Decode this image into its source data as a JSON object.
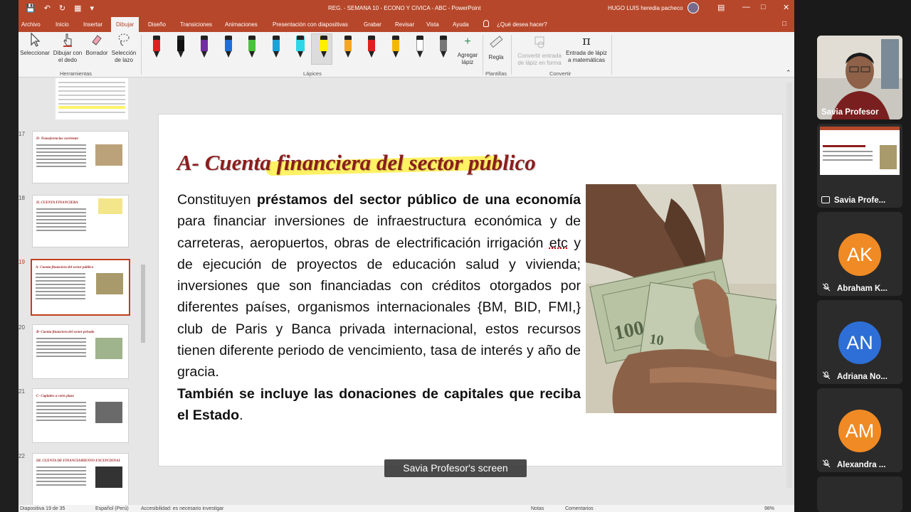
{
  "window": {
    "title": "REG. - SEMANA 10 - ECONO Y CIVICA - ABC  -  PowerPoint",
    "user": "HUGO LUIS heredia pacheco"
  },
  "tabs": [
    {
      "label": "Archivo"
    },
    {
      "label": "Inicio"
    },
    {
      "label": "Insertar"
    },
    {
      "label": "Dibujar"
    },
    {
      "label": "Diseño"
    },
    {
      "label": "Transiciones"
    },
    {
      "label": "Animaciones"
    },
    {
      "label": "Presentación con diapositivas"
    },
    {
      "label": "Grabar"
    },
    {
      "label": "Revisar"
    },
    {
      "label": "Vista"
    },
    {
      "label": "Ayuda"
    },
    {
      "label": "¿Qué desea hacer?"
    }
  ],
  "ribbon": {
    "select": "Seleccionar",
    "finger": "Dibujar con el dedo",
    "eraser": "Borrador",
    "lasso": "Selección de lazo",
    "group_tools": "Herramientas",
    "group_pens": "Lápices",
    "add_pen": "Agregar lápiz",
    "ruler": "Regla",
    "group_stencils": "Plantillas",
    "ink_to_shape": "Convertir entrada de lápiz en forma",
    "ink_to_math": "Entrada de lápiz a matemáticas",
    "group_convert": "Convertir",
    "pen_colors": [
      "#e02020",
      "#111111",
      "#7030a0",
      "#1f6fd6",
      "#49c23c",
      "#1aa3d9",
      "#2fd6e6",
      "#fff000",
      "#f5a623",
      "#e02020",
      "#f5b800",
      "#ffffff",
      "#777777"
    ]
  },
  "thumbnails": [
    {
      "number": "17",
      "title": "D- Transferencias corrientes"
    },
    {
      "number": "18",
      "title": "II. CUENTA FINANCIERA"
    },
    {
      "number": "19",
      "title": "A- Cuenta financiera del sector público"
    },
    {
      "number": "20",
      "title": "B- Cuenta financiera del sector privado"
    },
    {
      "number": "21",
      "title": "C- Capitales a corto plazo"
    },
    {
      "number": "22",
      "title": "III. CUENTA DE FINANCIAMIENTO EXCEPCIONAL"
    }
  ],
  "slide": {
    "title": "A- Cuenta financiera del sector público",
    "p1_a": "Constituyen ",
    "p1_b": "préstamos del sector público de una economía",
    "p1_c": " para financiar inversiones de infraestructura económica y de carreteras, aeropuertos, obras de electrificación irrigación ",
    "p1_d": "etc",
    "p1_e": " y de ejecución de proyectos de educación salud y vivienda; inversiones que son financiadas con créditos otorgados por diferentes países, organismos internacionales {BM, BID, FMI,} club de Paris y Banca privada internacional, estos recursos tienen diferente periodo de vencimiento, tasa de interés y año de gracia.",
    "p2_a": "También se incluye las donaciones de capitales que reciba el Estado",
    "p2_b": "."
  },
  "statusbar": {
    "slide_info": "Diapositiva 19 de 35",
    "language": "Español (Perú)",
    "accessibility": "Accesibilidad: es necesario investigar",
    "notes": "Notas",
    "comments": "Comentarios",
    "zoom": "98%"
  },
  "share_label": "Savia Profesor's screen",
  "participants": [
    {
      "name": "Savia Profesor",
      "initials": "",
      "color": ""
    },
    {
      "name": "Savia Profe...",
      "initials": "",
      "color": ""
    },
    {
      "name": "Abraham K...",
      "initials": "AK",
      "color": "#f08a24"
    },
    {
      "name": "Adriana No...",
      "initials": "AN",
      "color": "#2d6fd6"
    },
    {
      "name": "Alexandra ...",
      "initials": "AM",
      "color": "#f08a24"
    }
  ]
}
